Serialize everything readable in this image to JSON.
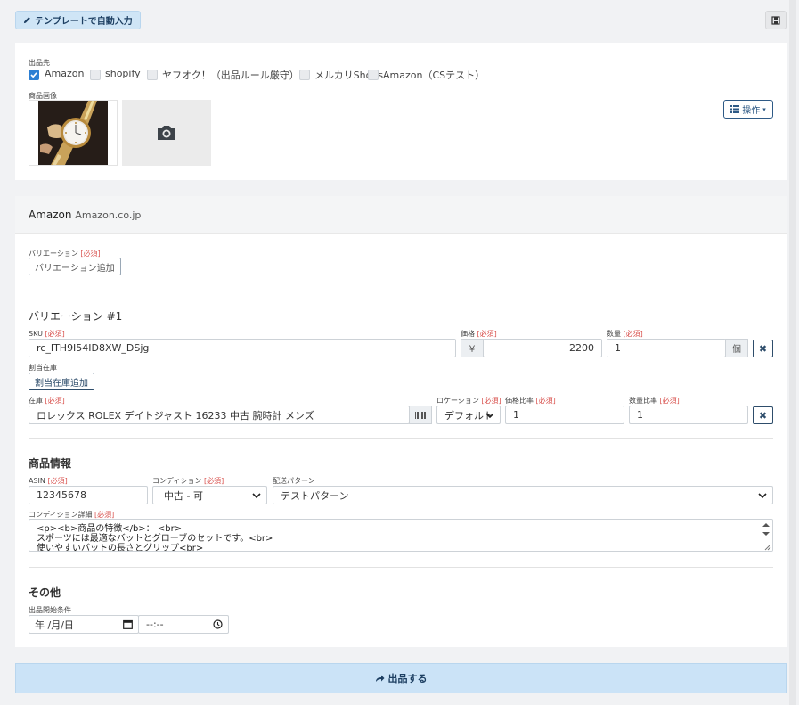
{
  "toolbar": {
    "autofill_label": "テンプレートで自動入力"
  },
  "destinations": {
    "label": "出品先",
    "items": [
      {
        "label": "Amazon",
        "checked": true
      },
      {
        "label": "shopify",
        "checked": false
      },
      {
        "label": "ヤフオク！（出品ルール厳守）",
        "checked": false
      },
      {
        "label": "メルカリShops",
        "checked": false
      },
      {
        "label": "Amazon（CSテスト）",
        "checked": false
      }
    ]
  },
  "images": {
    "label": "商品画像",
    "operations_label": "操作"
  },
  "amazon": {
    "title": "Amazon",
    "subtitle": "Amazon.co.jp",
    "variation_label": "バリエーション",
    "required": "[必須]",
    "add_variation": "バリエーション追加",
    "variation_title": "バリエーション #1",
    "sku_label": "SKU",
    "sku_value": "rc_ITH9I54ID8XW_DSjg",
    "price_label": "価格",
    "currency": "￥",
    "price_value": "2200",
    "qty_label": "数量",
    "qty_value": "1",
    "qty_unit": "個",
    "allocated_label": "割当在庫",
    "add_allocated": "割当在庫追加",
    "stock_label": "在庫",
    "stock_value": "ロレックス ROLEX デイトジャスト 16233 中古 腕時計 メンズ",
    "location_label": "ロケーション",
    "location_value": "デフォルト",
    "price_ratio_label": "価格比率",
    "price_ratio_value": "1",
    "qty_ratio_label": "数量比率",
    "qty_ratio_value": "1",
    "product_info_title": "商品情報",
    "asin_label": "ASIN",
    "asin_value": "12345678",
    "condition_label": "コンディション",
    "condition_value": "中古 - 可",
    "shipping_label": "配送パターン",
    "shipping_value": "テストパターン",
    "condition_detail_label": "コンディション詳細",
    "condition_detail_lines": [
      "<p><b>商品の特徴</b>： <br>",
      "スポーツには最適なバットとグローブのセットです。<br>",
      "使いやすいバットの長さとグリップ<br>"
    ],
    "other_title": "その他",
    "start_label": "出品開始条件",
    "date_placeholder": "年 /月/日",
    "time_placeholder": "--:--"
  },
  "submit_label": "出品する",
  "colors": {
    "accent": "#2d7fd3",
    "button_bg": "#cbe3f7",
    "required": "#d9534f"
  }
}
